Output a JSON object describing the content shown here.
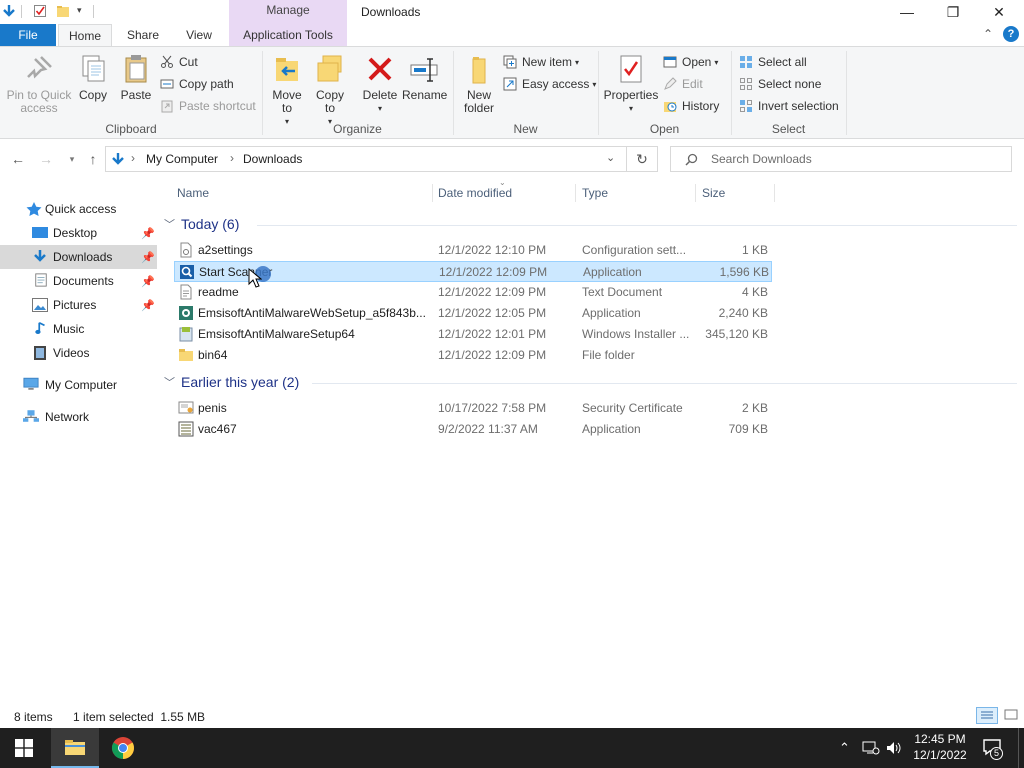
{
  "window": {
    "title": "Downloads",
    "manage_label": "Manage",
    "minimize": "—",
    "maximize": "❐",
    "close": "✕"
  },
  "tabs": {
    "file": "File",
    "home": "Home",
    "share": "Share",
    "view": "View",
    "application_tools": "Application Tools",
    "collapse": "⌃",
    "help": "?"
  },
  "ribbon": {
    "clipboard": {
      "label": "Clipboard",
      "pin": "Pin to Quick access",
      "copy": "Copy",
      "paste": "Paste",
      "cut": "Cut",
      "copy_path": "Copy path",
      "paste_shortcut": "Paste shortcut"
    },
    "organize": {
      "label": "Organize",
      "move_to": "Move to",
      "copy_to": "Copy to",
      "delete": "Delete",
      "rename": "Rename"
    },
    "new": {
      "label": "New",
      "new_folder": "New folder",
      "new_item": "New item",
      "easy_access": "Easy access"
    },
    "open": {
      "label": "Open",
      "properties": "Properties",
      "open": "Open",
      "edit": "Edit",
      "history": "History"
    },
    "select": {
      "label": "Select",
      "select_all": "Select all",
      "select_none": "Select none",
      "invert": "Invert selection"
    }
  },
  "address": {
    "crumbs": [
      "My Computer",
      "Downloads"
    ],
    "search_placeholder": "Search Downloads"
  },
  "nav": {
    "quick_access": "Quick access",
    "desktop": "Desktop",
    "downloads": "Downloads",
    "documents": "Documents",
    "pictures": "Pictures",
    "music": "Music",
    "videos": "Videos",
    "my_computer": "My Computer",
    "network": "Network"
  },
  "columns": {
    "name": "Name",
    "date": "Date modified",
    "type": "Type",
    "size": "Size"
  },
  "groups": [
    {
      "title": "Today (6)",
      "files": [
        {
          "name": "a2settings",
          "date": "12/1/2022 12:10 PM",
          "type": "Configuration sett...",
          "size": "1 KB",
          "icon": "config-file-icon"
        },
        {
          "name": "Start Scanner",
          "date": "12/1/2022 12:09 PM",
          "type": "Application",
          "size": "1,596 KB",
          "icon": "scanner-app-icon"
        },
        {
          "name": "readme",
          "date": "12/1/2022 12:09 PM",
          "type": "Text Document",
          "size": "4 KB",
          "icon": "text-file-icon"
        },
        {
          "name": "EmsisoftAntiMalwareWebSetup_a5f843b...",
          "date": "12/1/2022 12:05 PM",
          "type": "Application",
          "size": "2,240 KB",
          "icon": "setup-app-icon"
        },
        {
          "name": "EmsisoftAntiMalwareSetup64",
          "date": "12/1/2022 12:01 PM",
          "type": "Windows Installer ...",
          "size": "345,120 KB",
          "icon": "installer-icon"
        },
        {
          "name": "bin64",
          "date": "12/1/2022 12:09 PM",
          "type": "File folder",
          "size": "",
          "icon": "folder-icon"
        }
      ]
    },
    {
      "title": "Earlier this year (2)",
      "files": [
        {
          "name": "penis",
          "date": "10/17/2022 7:58 PM",
          "type": "Security Certificate",
          "size": "2 KB",
          "icon": "certificate-icon"
        },
        {
          "name": "vac467",
          "date": "9/2/2022 11:37 AM",
          "type": "Application",
          "size": "709 KB",
          "icon": "exe-app-icon"
        }
      ]
    }
  ],
  "status": {
    "items": "8 items",
    "selected": "1 item selected  1.55 MB"
  },
  "taskbar": {
    "time": "12:45 PM",
    "date": "12/1/2022",
    "notifications": "5"
  },
  "colors": {
    "accent": "#1979ca",
    "manage_tab": "#e9d9f4",
    "selection": "#cce8ff",
    "taskbar": "#1f1f1f"
  }
}
